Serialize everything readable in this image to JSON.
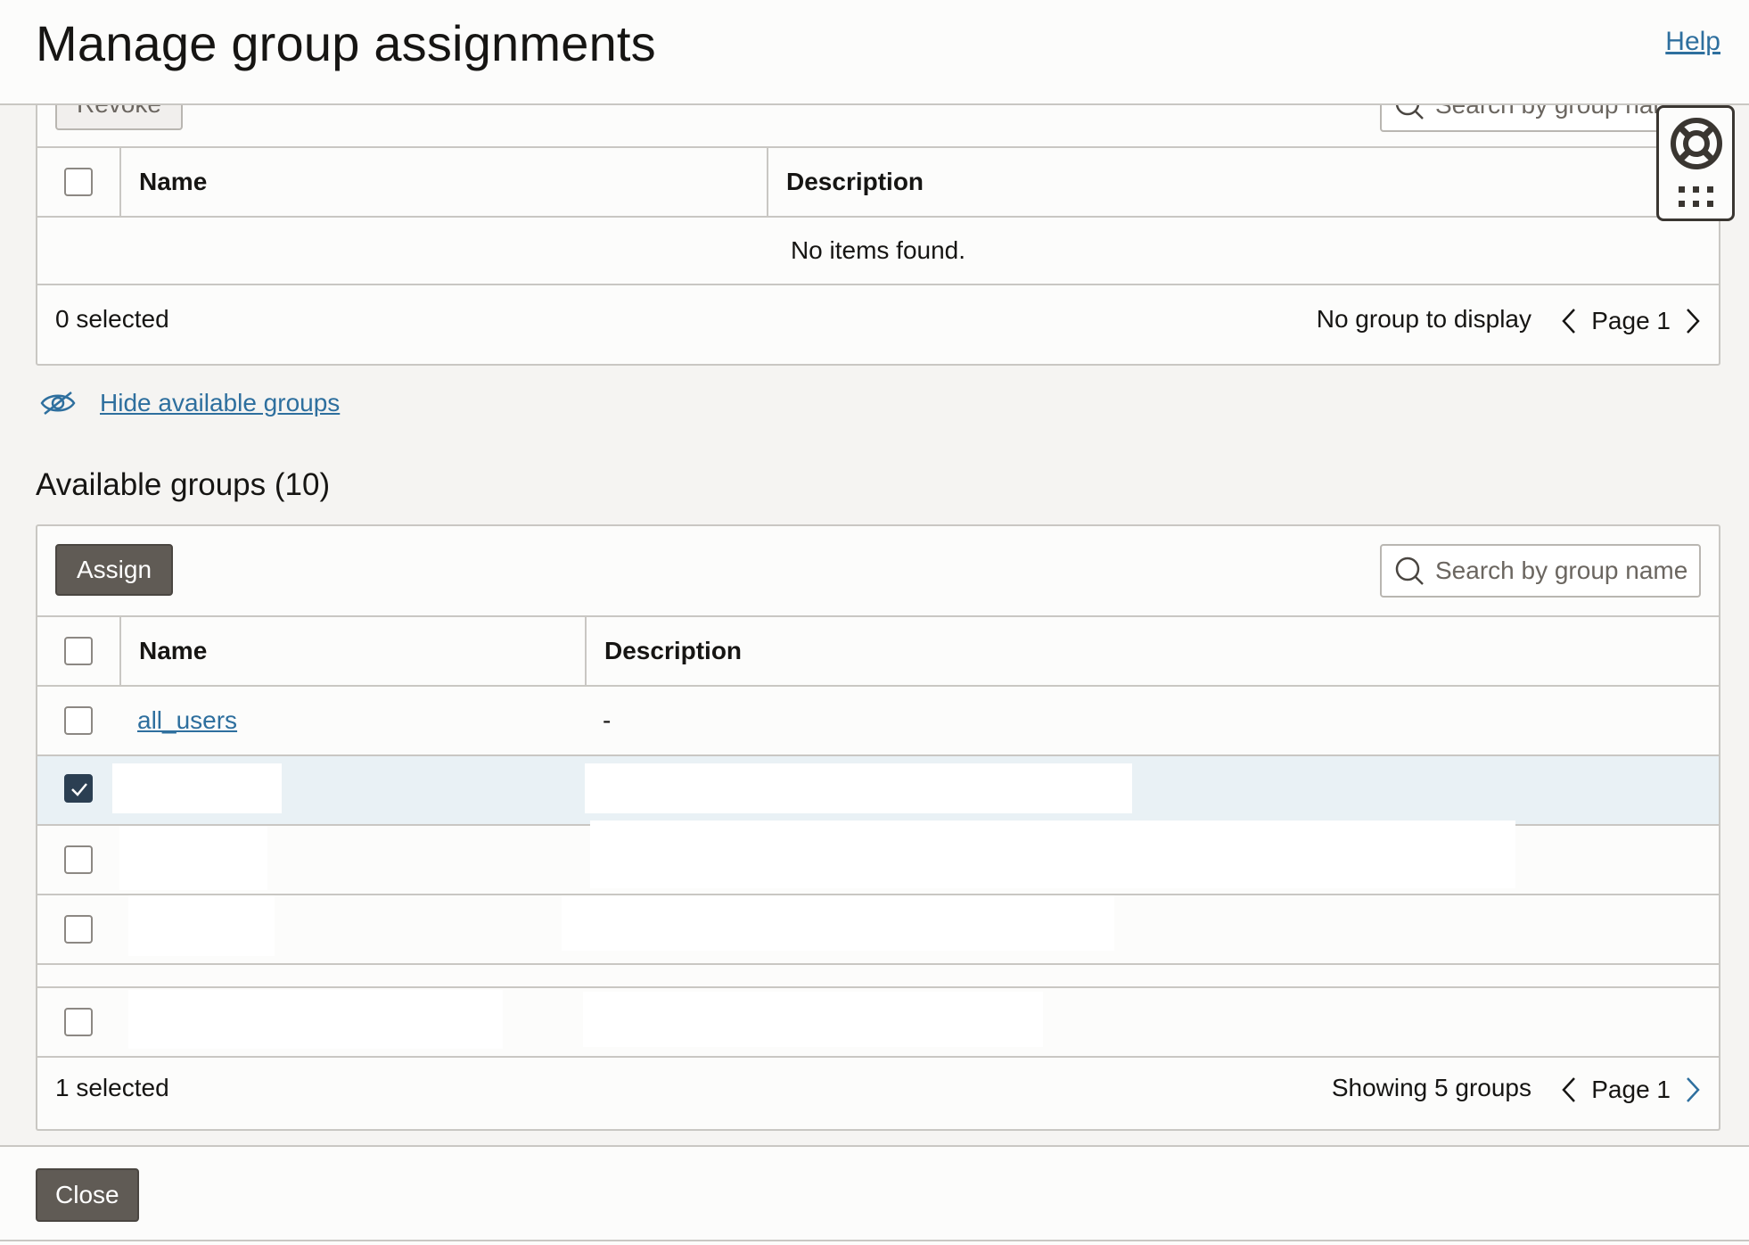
{
  "header": {
    "title": "Manage group assignments",
    "help_label": "Help"
  },
  "assigned": {
    "revoke_label": "Revoke",
    "search_placeholder": "Search by group name",
    "columns": {
      "name": "Name",
      "description": "Description"
    },
    "empty_text": "No items found.",
    "selected_text": "0 selected",
    "summary_text": "No group to display",
    "page_label": "Page 1"
  },
  "toggle": {
    "label": "Hide available groups",
    "icon": "eye-slash-icon"
  },
  "available": {
    "heading": "Available groups (10)",
    "assign_label": "Assign",
    "search_placeholder": "Search by group name",
    "columns": {
      "name": "Name",
      "description": "Description"
    },
    "rows": [
      {
        "name": "all_users",
        "description": "-",
        "checked": false
      },
      {
        "name": "",
        "description": "",
        "checked": true
      },
      {
        "name": "",
        "description": "",
        "checked": false
      },
      {
        "name": "",
        "description": "",
        "checked": false
      },
      {
        "name": "",
        "description": "",
        "checked": false
      }
    ],
    "selected_text": "1 selected",
    "summary_text": "Showing 5 groups",
    "page_label": "Page 1"
  },
  "footer": {
    "close_label": "Close"
  },
  "colors": {
    "link": "#2e6f9e",
    "button_dark": "#605b55",
    "selected_row": "#e9f1f5",
    "checkbox_checked": "#2b3f52"
  }
}
